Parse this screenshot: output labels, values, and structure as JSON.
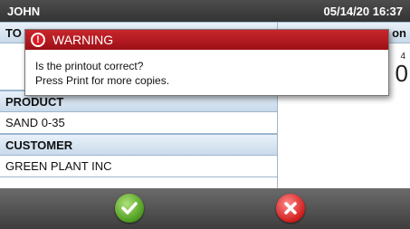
{
  "topbar": {
    "user": "JOHN",
    "datetime": "05/14/20 16:37"
  },
  "left": {
    "header_partial": "TO",
    "product_header": "PRODUCT",
    "product_value": "SAND 0-35",
    "customer_header": "CUSTOMER",
    "customer_value": "GREEN PLANT INC"
  },
  "right": {
    "header_partial": "on",
    "small_value": "4",
    "big_value": "0"
  },
  "dialog": {
    "title": "WARNING",
    "icon": "exclamation-icon",
    "message_line1": "Is the printout correct?",
    "message_line2": "Press Print for more copies."
  },
  "actions": {
    "confirm_icon": "check-icon",
    "cancel_icon": "x-icon"
  },
  "colors": {
    "warning_red": "#b5161d",
    "header_blue": "#c9daea",
    "confirm_green": "#4c9b1c",
    "cancel_red": "#d11c1c"
  }
}
